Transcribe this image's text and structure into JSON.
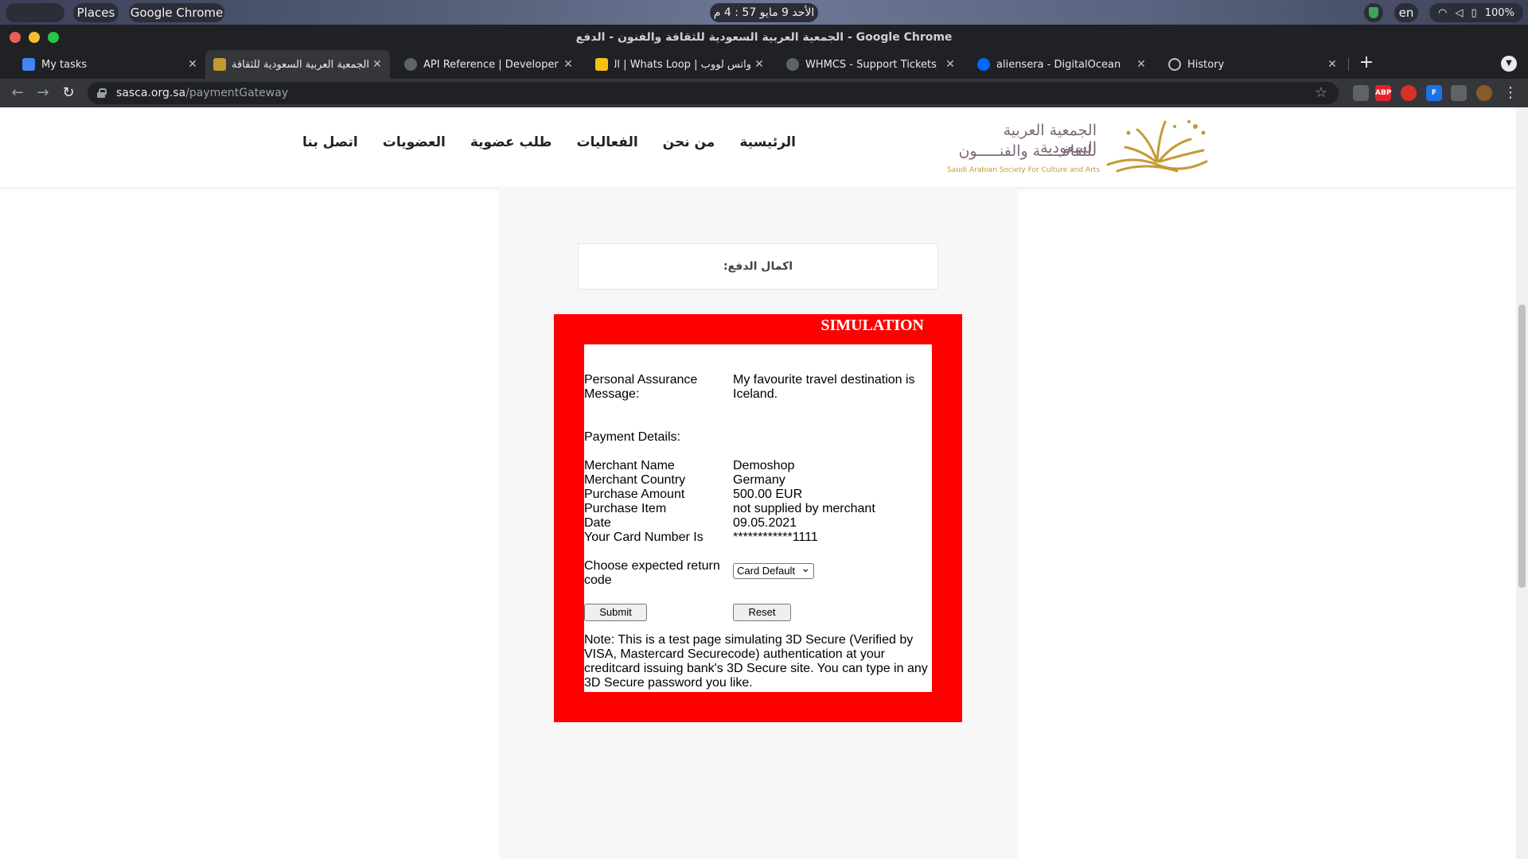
{
  "os_bar": {
    "apple_icon": "apple-logo-icon",
    "places": "Places",
    "app_name": "Google Chrome",
    "clock": "الأحد 9 مايو 57 : 4 م",
    "language": "en",
    "battery": "100%"
  },
  "window": {
    "title": "الجمعية العربية السعودية للثقافة والفنون - الدفع - Google Chrome"
  },
  "tabs": [
    {
      "label": "My tasks",
      "favicon_color": "#4285f4"
    },
    {
      "label": "الجمعية العربية السعودية للثقافة وا",
      "favicon_color": "#c49a33",
      "active": true
    },
    {
      "label": "API Reference | Developer Po",
      "favicon_color": "#e8eaed"
    },
    {
      "label": "واتس لووب | Whats Loop | الـ",
      "favicon_color": "#f4c20d"
    },
    {
      "label": "WHMCS - Support Tickets",
      "favicon_color": "#e8eaed"
    },
    {
      "label": "aliensera - DigitalOcean",
      "favicon_color": "#0069ff"
    },
    {
      "label": "History",
      "favicon_color": "#e8eaed"
    }
  ],
  "address": {
    "host": "sasca.org.sa",
    "path": "/paymentGateway"
  },
  "extensions": [
    {
      "name": "cursor-ext-icon",
      "text": "",
      "color": "#5f6368"
    },
    {
      "name": "adblock-plus-icon",
      "text": "ABP",
      "color": "#e4222e"
    },
    {
      "name": "red-ext-icon",
      "text": "",
      "color": "#d93025"
    },
    {
      "name": "blue-ext-icon",
      "text": "F",
      "color": "#1a73e8"
    },
    {
      "name": "puzzle-icon",
      "text": "",
      "color": "#5f6368"
    },
    {
      "name": "profile-avatar-icon",
      "text": "",
      "color": "#8a5a2b"
    }
  ],
  "site": {
    "logo_ar_line1": "الجمعية العربية السعودية",
    "logo_ar_line2": "للثقافـــــة والفنـــــون",
    "logo_en": "Saudi Arabian Society For Culture and Arts",
    "nav": [
      "الرئيسية",
      "من نحن",
      "الفعاليات",
      "طلب عضوية",
      "العضويات",
      "اتصل بنا"
    ],
    "brand_color": "#c49a33"
  },
  "payment": {
    "heading": "اكمال الدفع:",
    "simulation_title": "SIMULATION",
    "pam_label": "Personal Assurance Message:",
    "pam_value": "My favourite travel destination is Iceland.",
    "details_heading": "Payment Details:",
    "rows": [
      {
        "label": "Merchant Name",
        "value": "Demoshop"
      },
      {
        "label": "Merchant Country",
        "value": "Germany"
      },
      {
        "label": "Purchase Amount",
        "value": "500.00 EUR"
      },
      {
        "label": "Purchase Item",
        "value": "not supplied by merchant"
      },
      {
        "label": "Date",
        "value": "09.05.2021"
      },
      {
        "label": "Your Card Number Is",
        "value": "************1111"
      }
    ],
    "return_code_label": "Choose expected return code",
    "return_code_selected": "Card Default",
    "submit_label": "Submit",
    "reset_label": "Reset",
    "note": "Note: This is a test page simulating 3D Secure (Verified by VISA, Mastercard Securecode) authentication at your creditcard issuing bank's 3D Secure site. You can type in any 3D Secure password you like.",
    "frame_color": "#ff0000"
  }
}
